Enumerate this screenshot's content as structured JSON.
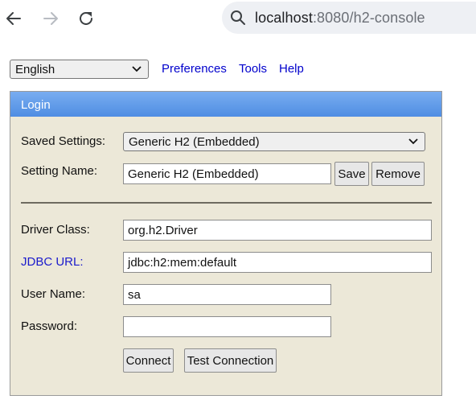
{
  "browser": {
    "url_host": "localhost",
    "url_rest": ":8080/h2-console"
  },
  "menu": {
    "language": "English",
    "links": [
      "Preferences",
      "Tools",
      "Help"
    ]
  },
  "login": {
    "title": "Login",
    "saved_settings_label": "Saved Settings:",
    "saved_settings_value": "Generic H2 (Embedded)",
    "setting_name_label": "Setting Name:",
    "setting_name_value": "Generic H2 (Embedded)",
    "save_label": "Save",
    "remove_label": "Remove",
    "driver_class_label": "Driver Class:",
    "driver_class_value": "org.h2.Driver",
    "jdbc_url_label": "JDBC URL:",
    "jdbc_url_value": "jdbc:h2:mem:default",
    "user_name_label": "User Name:",
    "user_name_value": "sa",
    "password_label": "Password:",
    "password_value": "",
    "connect_label": "Connect",
    "test_connection_label": "Test Connection"
  },
  "colors": {
    "panel_bg": "#ece8d8",
    "header_gradient_top": "#79adf0",
    "header_gradient_bottom": "#4f8de3",
    "link": "#0000cc"
  }
}
